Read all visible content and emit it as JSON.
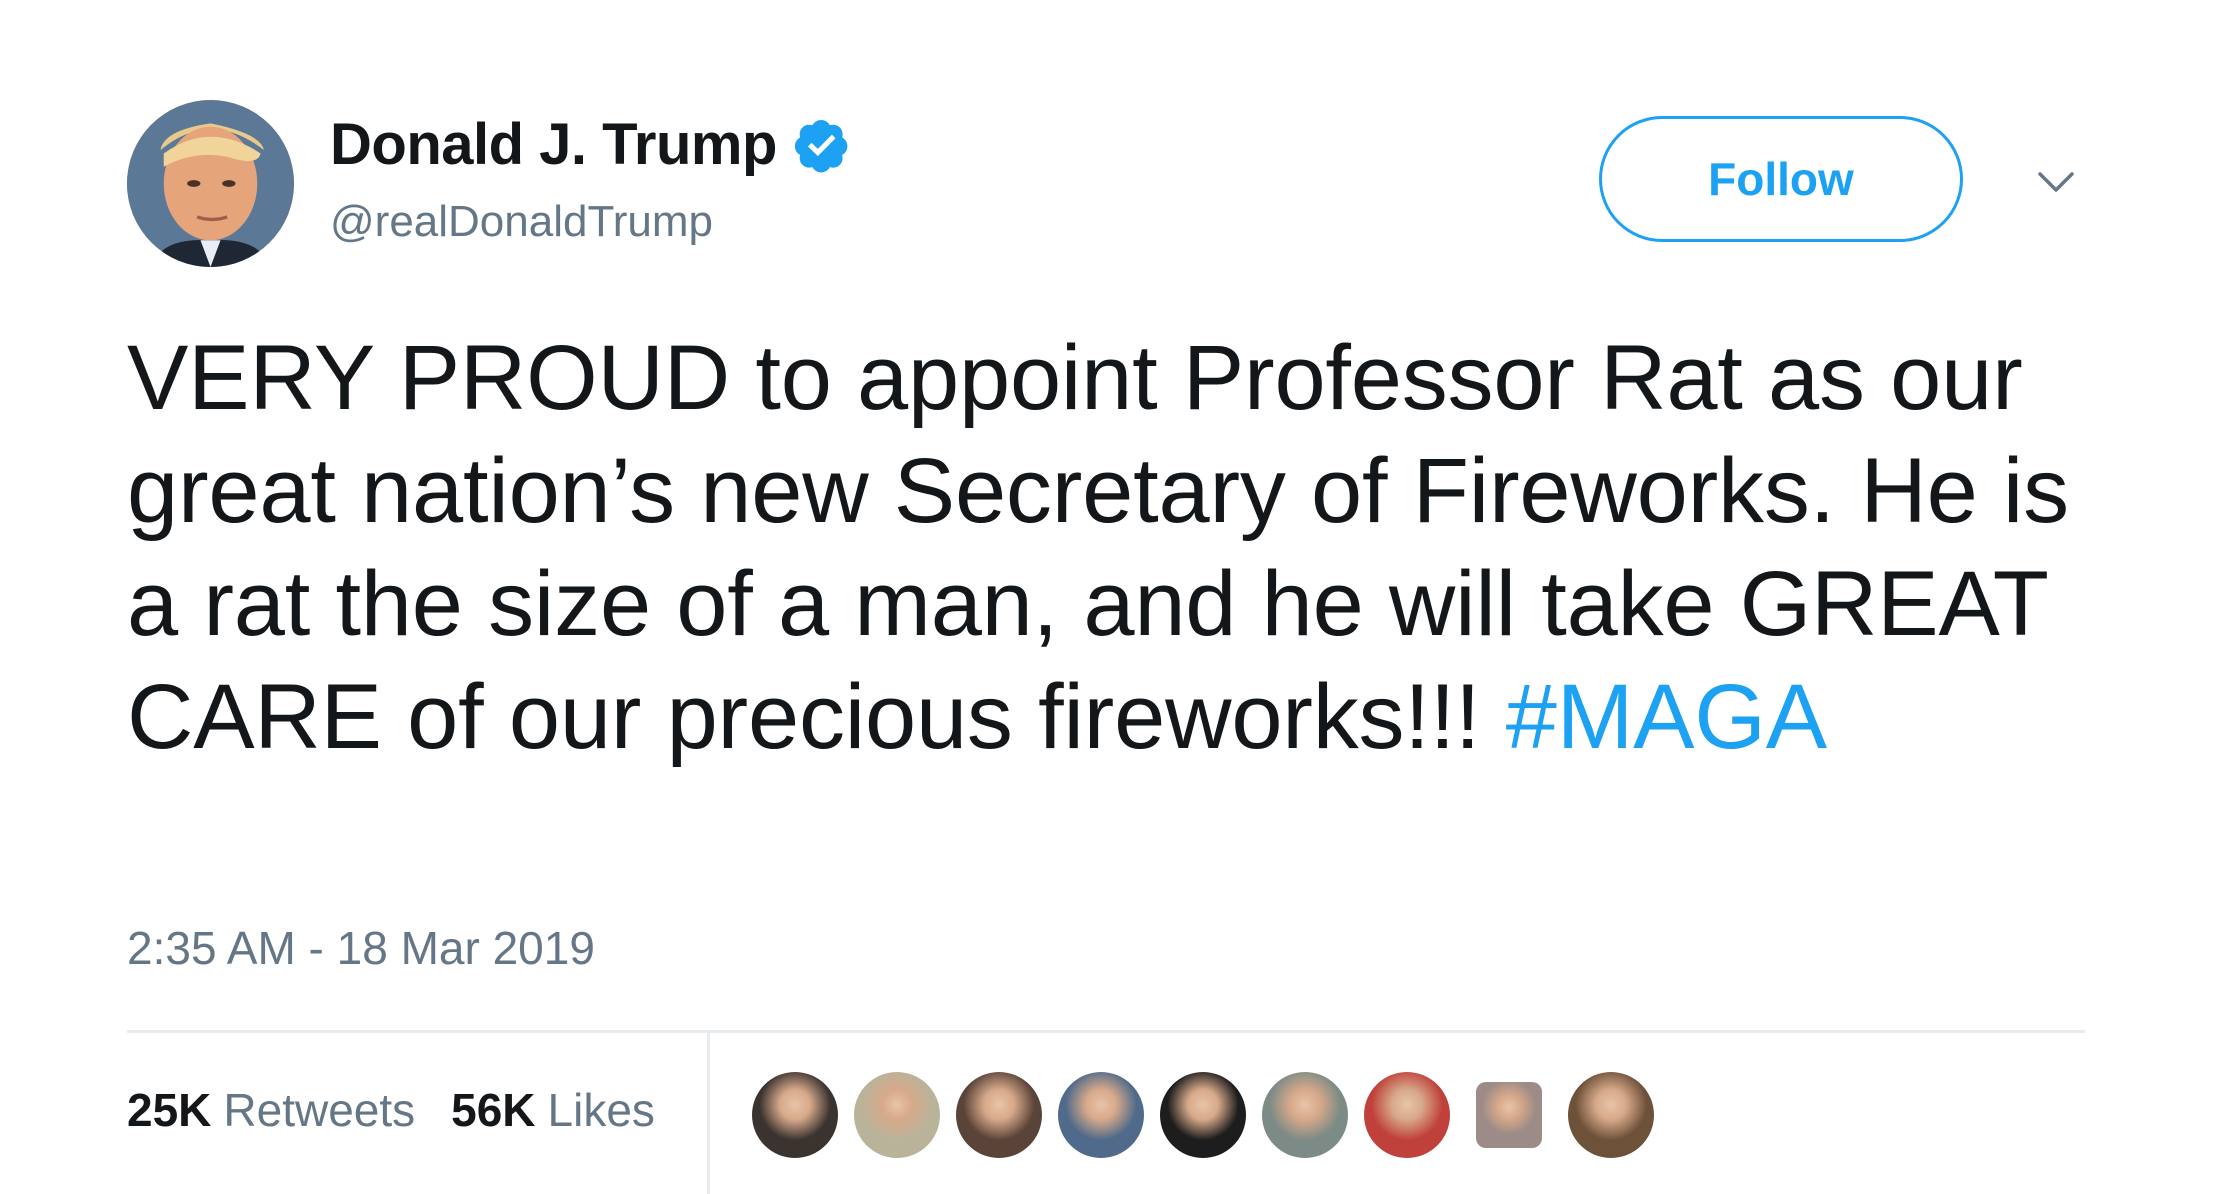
{
  "user": {
    "display_name": "Donald J. Trump",
    "handle": "@realDonaldTrump",
    "verified": true
  },
  "actions": {
    "follow_label": "Follow",
    "caret_icon": "chevron-down-icon"
  },
  "tweet": {
    "text": "VERY PROUD to appoint Professor Rat as our great nation’s new Secretary of Fireworks. He is a rat the size of a man, and he will take GREAT CARE of our precious fireworks!!! ",
    "hashtag": "#MAGA",
    "timestamp": "2:35 AM - 18 Mar 2019"
  },
  "stats": {
    "retweets_count": "25K",
    "retweets_label": "Retweets",
    "likes_count": "56K",
    "likes_label": "Likes"
  },
  "likers": [
    {
      "name": "liker-avatar-1",
      "color": "#3a3330"
    },
    {
      "name": "liker-avatar-2",
      "color": "#b9b39a"
    },
    {
      "name": "liker-avatar-3",
      "color": "#5a4338"
    },
    {
      "name": "liker-avatar-4",
      "color": "#4f6a8a"
    },
    {
      "name": "liker-avatar-5",
      "color": "#1d1d1d"
    },
    {
      "name": "liker-avatar-6",
      "color": "#7d8b86"
    },
    {
      "name": "liker-avatar-7",
      "color": "#c0413c"
    },
    {
      "name": "liker-avatar-8",
      "color": "#9c8b86"
    },
    {
      "name": "liker-avatar-9",
      "color": "#6e5139"
    }
  ],
  "colors": {
    "accent": "#1da1f2",
    "text": "#14171a",
    "muted": "#657786",
    "divider": "#e6ecf0"
  }
}
